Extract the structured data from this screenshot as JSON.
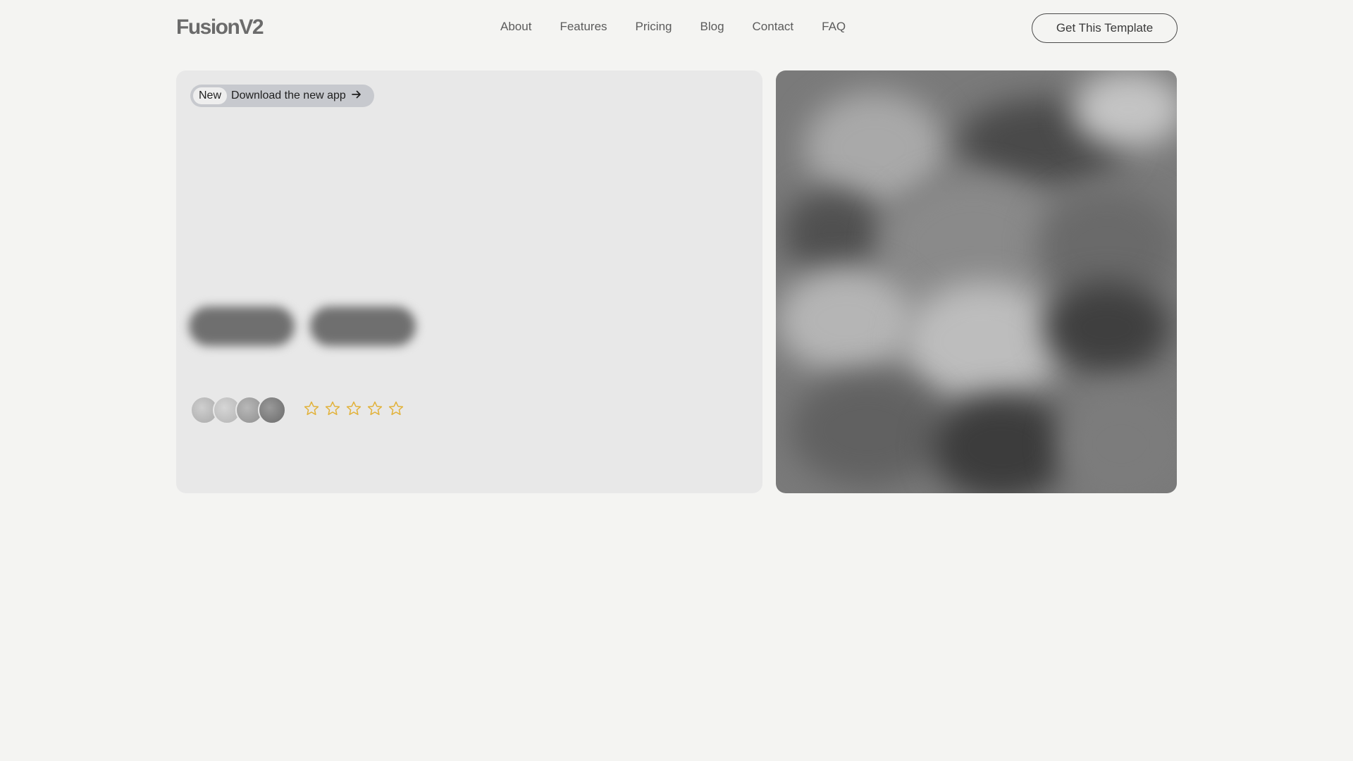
{
  "header": {
    "logo": "FusionV2",
    "nav": [
      "About",
      "Features",
      "Pricing",
      "Blog",
      "Contact",
      "FAQ"
    ],
    "cta_label": "Get This Template"
  },
  "hero": {
    "pill_badge": "New",
    "pill_text": "Download the new app",
    "pill_icon": "arrow-right-icon",
    "rating": {
      "value": 0,
      "max": 5,
      "star_color": "#e2b23a"
    },
    "avatars_count": 4
  },
  "colors": {
    "background": "#f4f4f2",
    "card": "#e8e8e8",
    "pill": "#c7c9ce"
  }
}
